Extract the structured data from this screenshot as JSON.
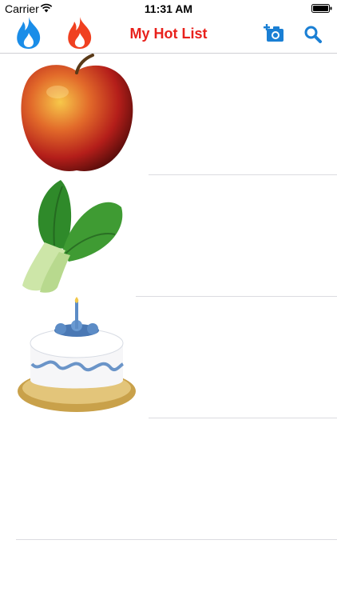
{
  "status_bar": {
    "carrier": "Carrier",
    "time": "11:31 AM",
    "icons": [
      "wifi-icon",
      "battery-icon"
    ]
  },
  "nav_bar": {
    "title": "My Hot List",
    "left_icons": [
      "flame-blue-icon",
      "flame-red-icon"
    ],
    "right_buttons": [
      "add-photo-camera-icon",
      "search-icon"
    ]
  },
  "list": {
    "rows": [
      {
        "image": "apple"
      },
      {
        "image": "bok-choy"
      },
      {
        "image": "birthday-cake"
      },
      {
        "image": ""
      }
    ]
  },
  "colors": {
    "title_red": "#e8211c",
    "flame_blue": "#1a8de8",
    "flame_red": "#f04020",
    "action_blue": "#1a7fd4",
    "separator": "#dcdce0"
  }
}
